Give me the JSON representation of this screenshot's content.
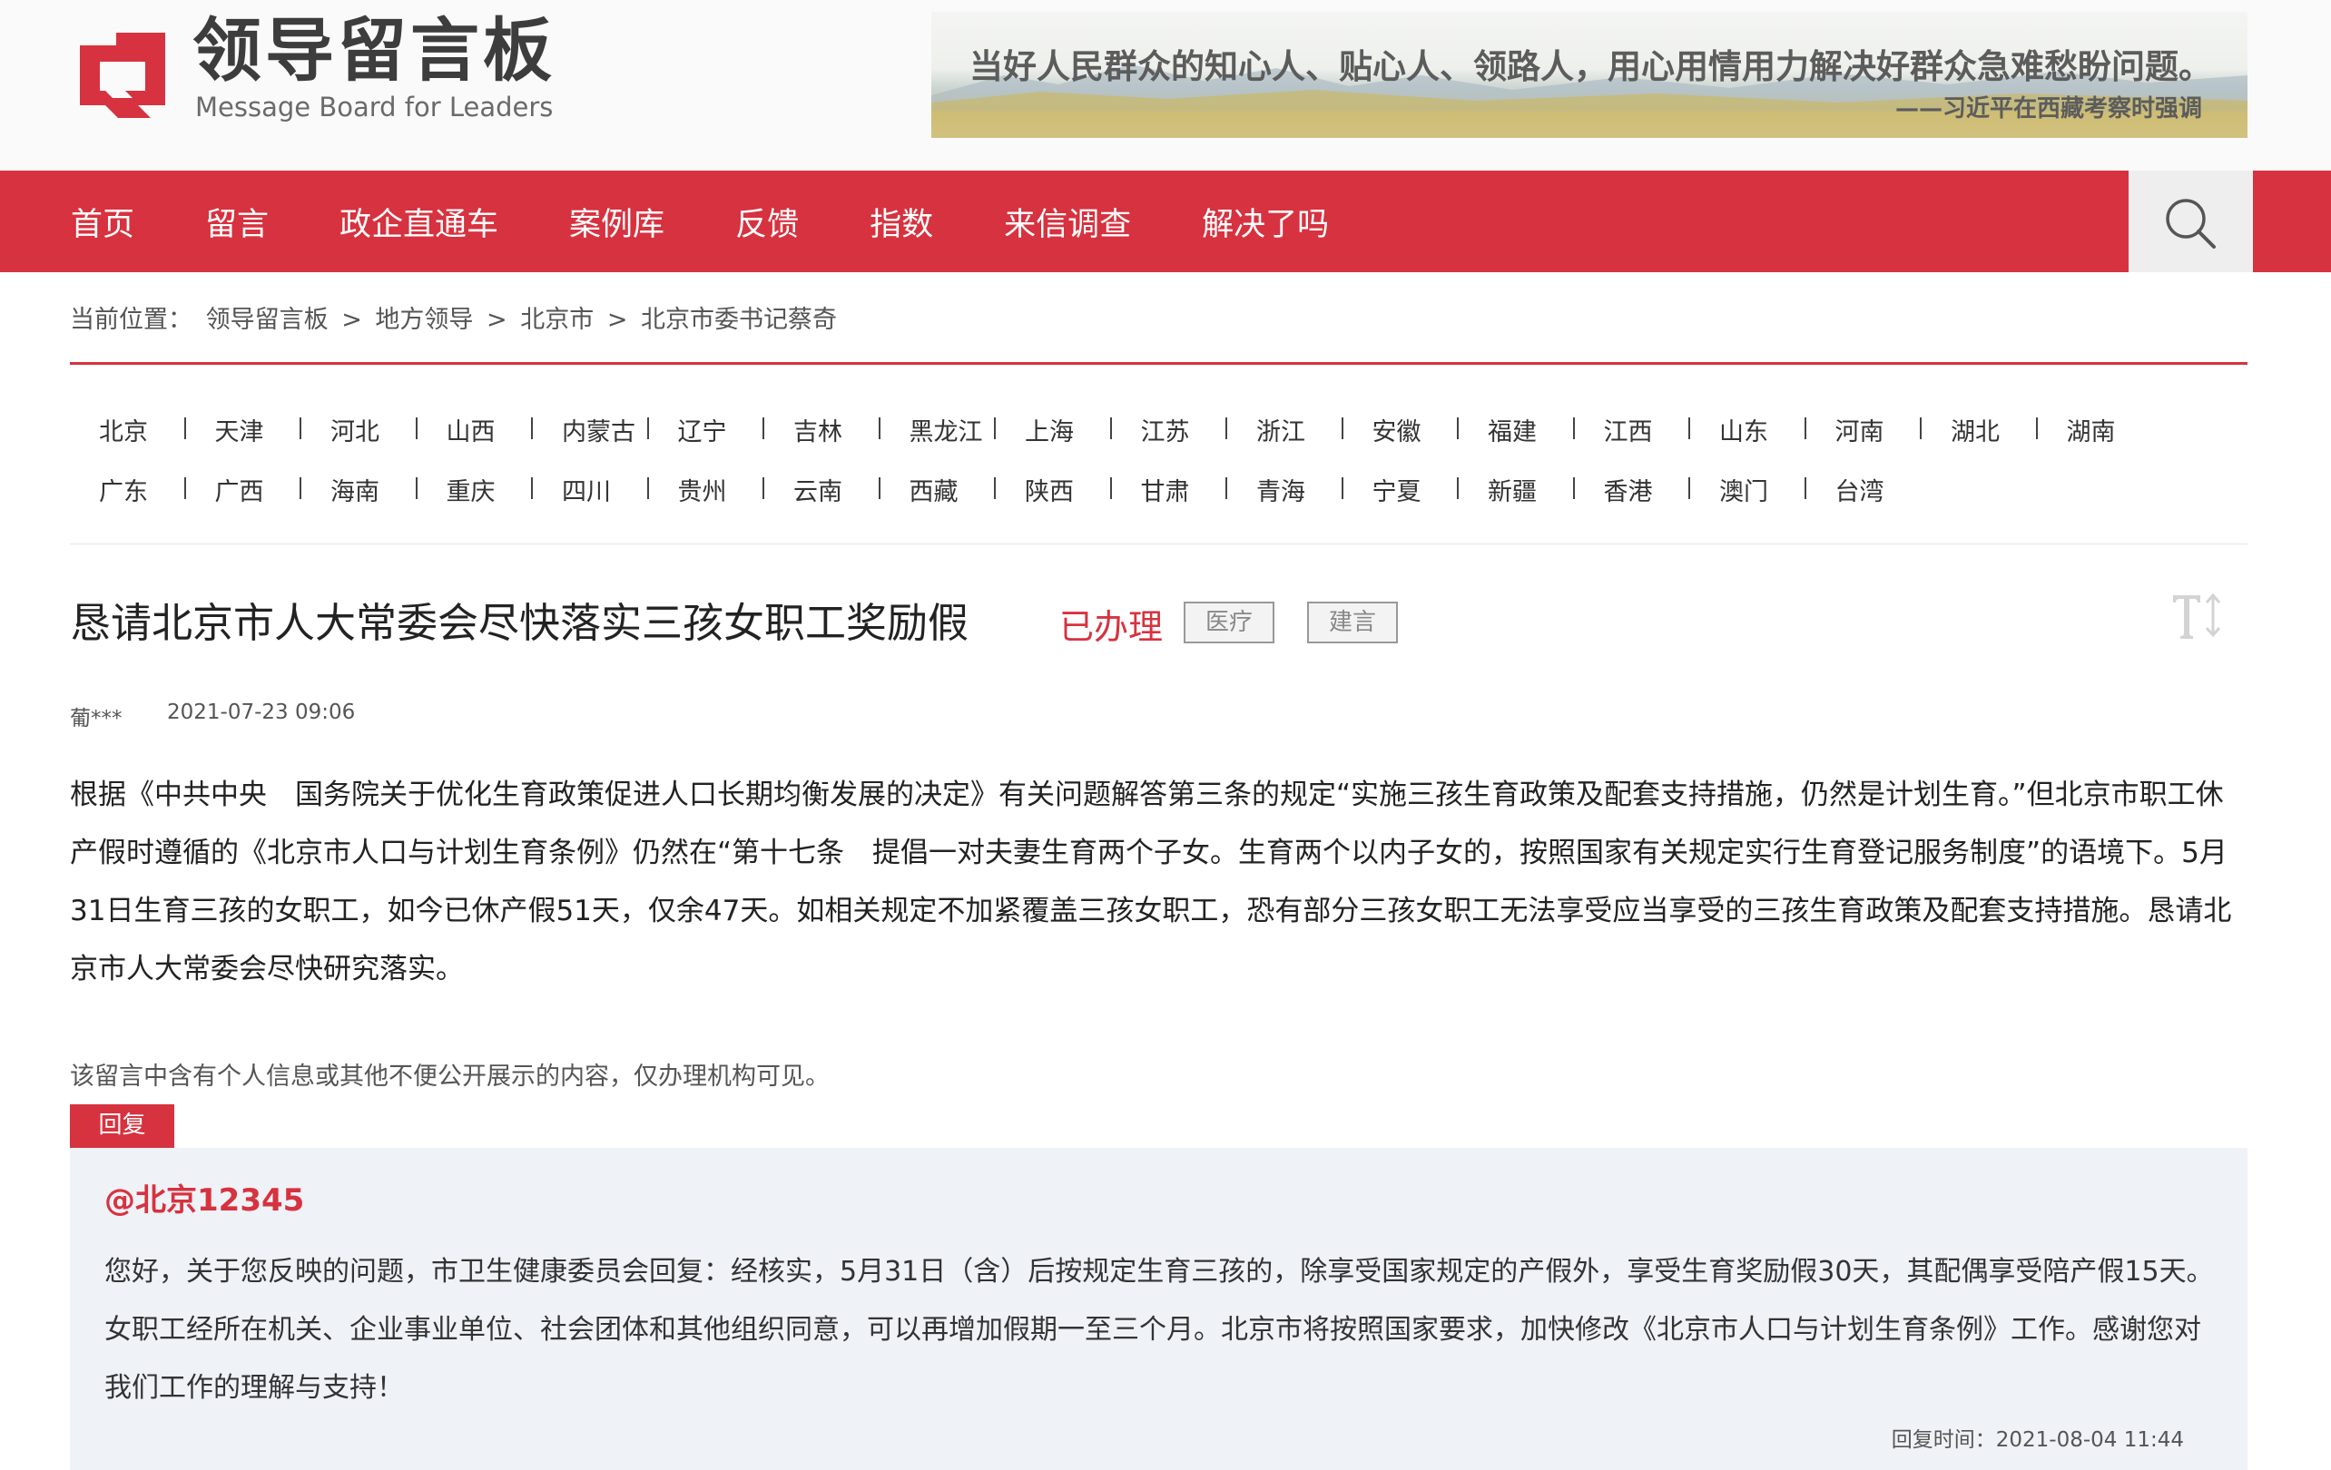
{
  "header": {
    "logo_title": "领导留言板",
    "logo_subtitle": "Message Board for Leaders",
    "banner_quote": "当好人民群众的知心人、贴心人、领路人，用心用情用力解决好群众急难愁盼问题。",
    "banner_attribution": "——习近平在西藏考察时强调"
  },
  "nav": {
    "items": [
      "首页",
      "留言",
      "政企直通车",
      "案例库",
      "反馈",
      "指数",
      "来信调查",
      "解决了吗"
    ],
    "search_icon": "search-icon"
  },
  "breadcrumb": {
    "prefix": "当前位置：",
    "items": [
      "领导留言板",
      "地方领导",
      "北京市",
      "北京市委书记蔡奇"
    ],
    "separator": ">"
  },
  "provinces": {
    "row1": [
      "北京",
      "天津",
      "河北",
      "山西",
      "内蒙古",
      "辽宁",
      "吉林",
      "黑龙江",
      "上海",
      "江苏",
      "浙江",
      "安徽",
      "福建",
      "江西",
      "山东",
      "河南",
      "湖北",
      "湖南"
    ],
    "row2": [
      "广东",
      "广西",
      "海南",
      "重庆",
      "四川",
      "贵州",
      "云南",
      "西藏",
      "陕西",
      "甘肃",
      "青海",
      "宁夏",
      "新疆",
      "香港",
      "澳门",
      "台湾"
    ]
  },
  "message": {
    "title": "恳请北京市人大常委会尽快落实三孩女职工奖励假",
    "status": "已办理",
    "tags": [
      "医疗",
      "建言"
    ],
    "author": "葡***",
    "date": "2021-07-23 09:06",
    "body": "根据《中共中央　国务院关于优化生育政策促进人口长期均衡发展的决定》有关问题解答第三条的规定“实施三孩生育政策及配套支持措施，仍然是计划生育。”但北京市职工休产假时遵循的《北京市人口与计划生育条例》仍然在“第十七条　提倡一对夫妻生育两个子女。生育两个以内子女的，按照国家有关规定实行生育登记服务制度”的语境下。5月31日生育三孩的女职工，如今已休产假51天，仅余47天。如相关规定不加紧覆盖三孩女职工，恐有部分三孩女职工无法享受应当享受的三孩生育政策及配套支持措施。恳请北京市人大常委会尽快研究落实。",
    "privacy_notice": "该留言中含有个人信息或其他不便公开展示的内容，仅办理机构可见。"
  },
  "reply": {
    "tab_label": "回复",
    "from": "@北京12345",
    "text": "您好，关于您反映的问题，市卫生健康委员会回复：经核实，5月31日（含）后按规定生育三孩的，除享受国家规定的产假外，享受生育奖励假30天，其配偶享受陪产假15天。女职工经所在机关、企业事业单位、社会团体和其他组织同意，可以再增加假期一至三个月。北京市将按照国家要求，加快修改《北京市人口与计划生育条例》工作。感谢您对我们工作的理解与支持！",
    "time_label": "回复时间：2021-08-04 11:44"
  },
  "colors": {
    "brand_red": "#d7323f",
    "reply_bg": "#eff2f7"
  }
}
